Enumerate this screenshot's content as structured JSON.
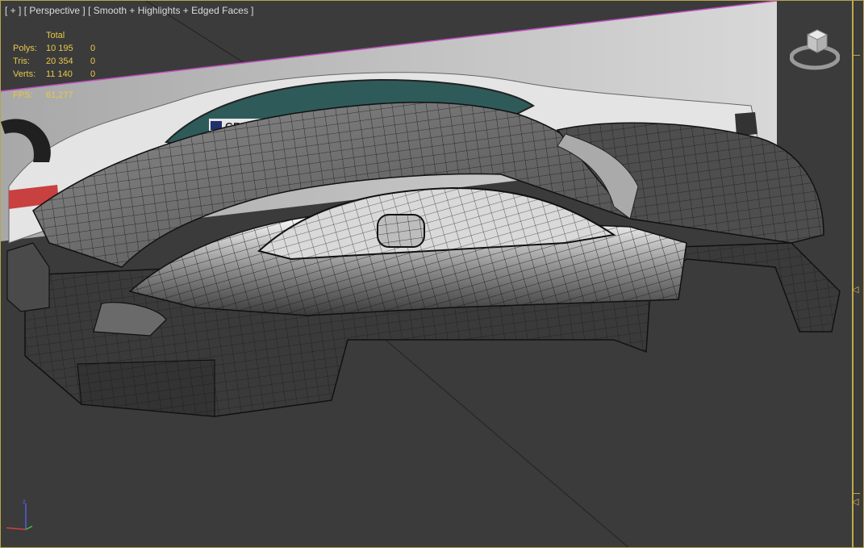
{
  "viewport": {
    "menu_plus": "[ + ]",
    "view_name": "[ Perspective ]",
    "shading_mode": "[ Smooth + Highlights + Edged Faces ]"
  },
  "stats": {
    "header_total": "Total",
    "rows": [
      {
        "label": "Polys:",
        "total": "10 195",
        "selected": "0"
      },
      {
        "label": "Tris:",
        "total": "20 354",
        "selected": "0"
      },
      {
        "label": "Verts:",
        "total": "11 140",
        "selected": "0"
      }
    ],
    "fps_label": "FPS:",
    "fps_value": "61,277"
  },
  "reference_image": {
    "banner_text": "GRE"
  },
  "colors": {
    "viewport_bg": "#3d3d3d",
    "stats_text": "#e8c84a",
    "active_border": "#b9a34e",
    "plane_edge": "#c050c0"
  },
  "icons": {
    "viewcube": "viewcube-icon",
    "axis_tripod": "axis-tripod-icon",
    "time_slider_marker": "triangle-left-icon"
  }
}
